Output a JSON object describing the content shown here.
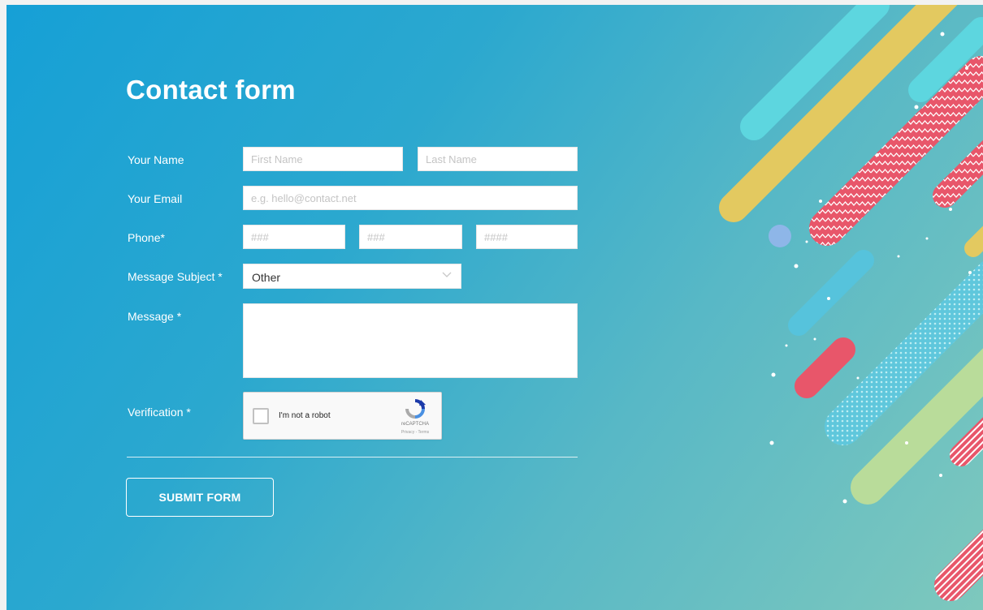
{
  "form": {
    "title": "Contact form",
    "name_label": "Your Name",
    "first_name_placeholder": "First Name",
    "last_name_placeholder": "Last Name",
    "email_label": "Your Email",
    "email_placeholder": "e.g. hello@contact.net",
    "phone_label": "Phone*",
    "phone_area_placeholder": "###",
    "phone_prefix_placeholder": "###",
    "phone_line_placeholder": "####",
    "subject_label": "Message Subject *",
    "subject_value": "Other",
    "message_label": "Message *",
    "message_value": "",
    "verification_label": "Verification *",
    "submit_label": "SUBMIT FORM"
  },
  "captcha": {
    "text": "I'm not a robot",
    "brand": "reCAPTCHA",
    "links": "Privacy - Terms",
    "checked": false
  },
  "colors": {
    "background_start": "#16a0d6",
    "background_end": "#7ec8bd",
    "accent_yellow": "#e8c74f",
    "accent_red": "#e8566a",
    "accent_cyan": "#5dd6df",
    "accent_green": "#c9e27a"
  }
}
